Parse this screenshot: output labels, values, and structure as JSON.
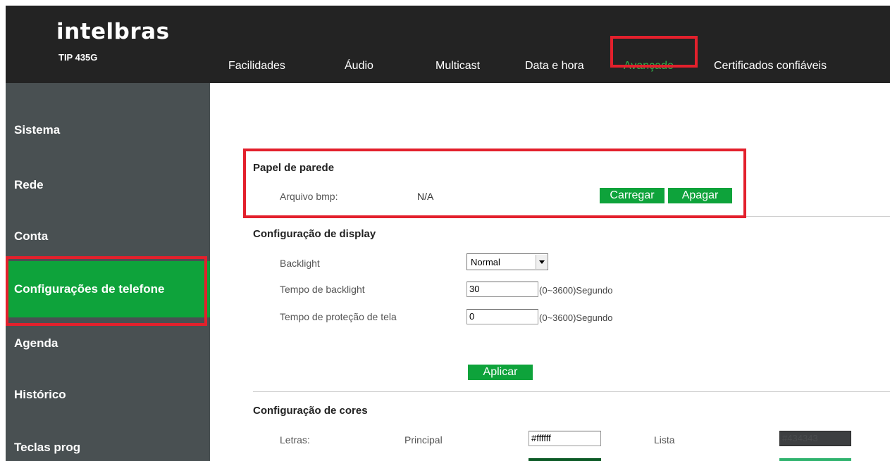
{
  "header": {
    "brand": "intelbras",
    "model": "TIP 435G",
    "tabs": [
      {
        "label": "Facilidades"
      },
      {
        "label": "Áudio"
      },
      {
        "label": "Multicast"
      },
      {
        "label": "Data e hora"
      },
      {
        "label": "Avançado",
        "active": true
      },
      {
        "label": "Certificados confiáveis"
      }
    ]
  },
  "sidebar": {
    "items": [
      {
        "label": "Sistema"
      },
      {
        "label": "Rede"
      },
      {
        "label": "Conta"
      },
      {
        "label": "Configurações de telefone",
        "active": true
      },
      {
        "label": "Agenda"
      },
      {
        "label": "Histórico"
      },
      {
        "label": "Teclas prog"
      }
    ]
  },
  "wallpaper": {
    "title": "Papel de parede",
    "file_label": "Arquivo bmp:",
    "file_value": "N/A",
    "upload_label": "Carregar",
    "delete_label": "Apagar"
  },
  "display": {
    "title": "Configuração de display",
    "backlight_label": "Backlight",
    "backlight_value": "Normal",
    "backlight_time_label": "Tempo de backlight",
    "backlight_time_value": "30",
    "backlight_time_hint": "(0~3600)Segundo",
    "screensaver_label": "Tempo de proteção de tela",
    "screensaver_value": "0",
    "screensaver_hint": "(0~3600)Segundo",
    "apply_label": "Aplicar"
  },
  "colors": {
    "title": "Configuração de cores",
    "letters_label": "Letras:",
    "main_label": "Principal",
    "main_value": "#ffffff",
    "list_label": "Lista",
    "list_value": "#434343"
  },
  "theme": {
    "accent": "#0ea33b",
    "header_bg": "#232323",
    "sidebar_bg": "#495052",
    "highlight": "#e3202c"
  }
}
